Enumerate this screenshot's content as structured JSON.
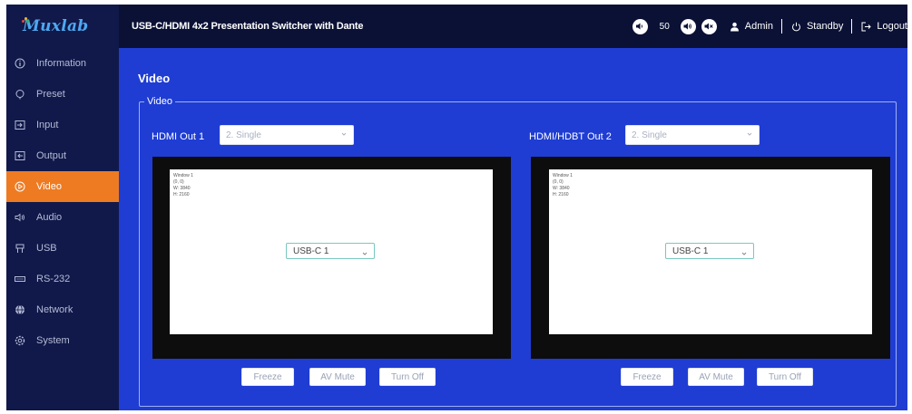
{
  "brand": {
    "logo_text": "Muxlab",
    "dot_colors": [
      "#e8453c",
      "#f2b233",
      "#37b24d"
    ]
  },
  "header": {
    "title": "USB-C/HDMI 4x2 Presentation Switcher with Dante",
    "volume": "50",
    "user": "Admin",
    "standby": "Standby",
    "logout": "Logout",
    "icons": [
      "volume-down-icon",
      "volume-up-icon",
      "mute-icon",
      "user-icon",
      "power-icon",
      "logout-icon"
    ]
  },
  "sidebar": {
    "items": [
      {
        "label": "Information",
        "icon": "info-icon",
        "active": false
      },
      {
        "label": "Preset",
        "icon": "preset-icon",
        "active": false
      },
      {
        "label": "Input",
        "icon": "input-icon",
        "active": false
      },
      {
        "label": "Output",
        "icon": "output-icon",
        "active": false
      },
      {
        "label": "Video",
        "icon": "video-icon",
        "active": true
      },
      {
        "label": "Audio",
        "icon": "audio-icon",
        "active": false
      },
      {
        "label": "USB",
        "icon": "usb-icon",
        "active": false
      },
      {
        "label": "RS-232",
        "icon": "rs232-icon",
        "active": false
      },
      {
        "label": "Network",
        "icon": "network-icon",
        "active": false
      },
      {
        "label": "System",
        "icon": "system-icon",
        "active": false
      }
    ]
  },
  "main": {
    "page_title": "Video",
    "legend": "Video",
    "outputs": [
      {
        "label": "HDMI Out 1",
        "layout": "2. Single",
        "window": {
          "title": "Window 1",
          "position": "(0, 0)",
          "width": "W: 3840",
          "height": "H: 2160"
        },
        "source": "USB-C 1",
        "buttons": {
          "freeze": "Freeze",
          "av_mute": "AV Mute",
          "turn_off": "Turn Off"
        }
      },
      {
        "label": "HDMI/HDBT Out 2",
        "layout": "2. Single",
        "window": {
          "title": "Window 1",
          "position": "(0, 0)",
          "width": "W: 3840",
          "height": "H: 2160"
        },
        "source": "USB-C 1",
        "buttons": {
          "freeze": "Freeze",
          "av_mute": "AV Mute",
          "turn_off": "Turn Off"
        }
      }
    ]
  },
  "colors": {
    "sidebar_bg": "#11194a",
    "header_bg": "#0b1135",
    "main_bg": "#1f3dd3",
    "accent": "#ee7b22",
    "logo": "#4ea8f0"
  }
}
